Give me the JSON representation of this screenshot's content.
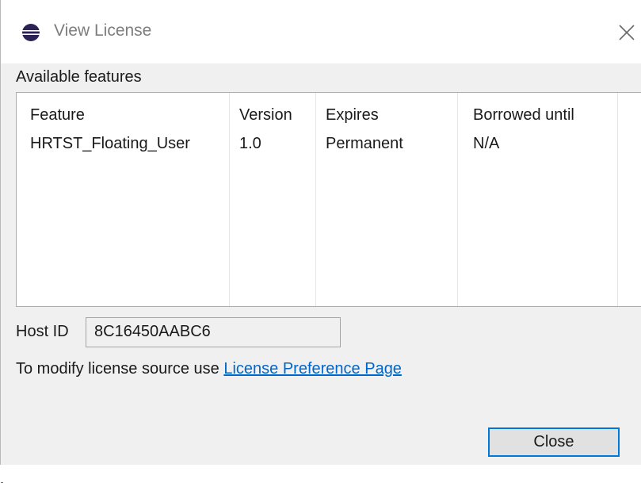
{
  "window": {
    "title": "View License",
    "close_icon": "close-icon",
    "app_icon": "eclipse-icon"
  },
  "features": {
    "label": "Available features",
    "columns": [
      "Feature",
      "Version",
      "Expires",
      "Borrowed until"
    ],
    "rows": [
      {
        "feature": "HRTST_Floating_User",
        "version": "1.0",
        "expires": "Permanent",
        "borrowed_until": "N/A"
      }
    ]
  },
  "host": {
    "label": "Host ID",
    "value": "8C16450AABC6"
  },
  "license_source": {
    "text": "To modify license source use ",
    "link_label": "License Preference Page"
  },
  "buttons": {
    "close_label": "Close"
  },
  "colors": {
    "accent": "#0078d7",
    "link": "#0066cc",
    "dialog_bg": "#f0f0f0"
  }
}
